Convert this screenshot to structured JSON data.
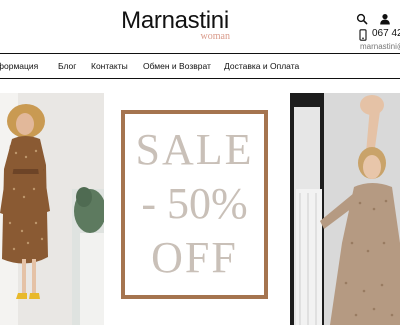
{
  "header": {
    "logo_main": "Marnastini",
    "logo_sub": "woman",
    "phone": "067 42",
    "email": "marnastini@g"
  },
  "icons": {
    "search": "search-icon",
    "user": "user-icon",
    "phone": "phone-icon"
  },
  "nav": {
    "items": [
      {
        "label": "формация"
      },
      {
        "label": "Блог"
      },
      {
        "label": "Контакты"
      },
      {
        "label": "Обмен и Возврат"
      },
      {
        "label": "Доставка и Оплата"
      }
    ]
  },
  "banner": {
    "line1": "SALE",
    "line2": "- 50%",
    "line3": "OFF"
  },
  "colors": {
    "accent": "#d99a8a",
    "frame": "#a5744f",
    "sale_text": "#c9c0b8"
  }
}
